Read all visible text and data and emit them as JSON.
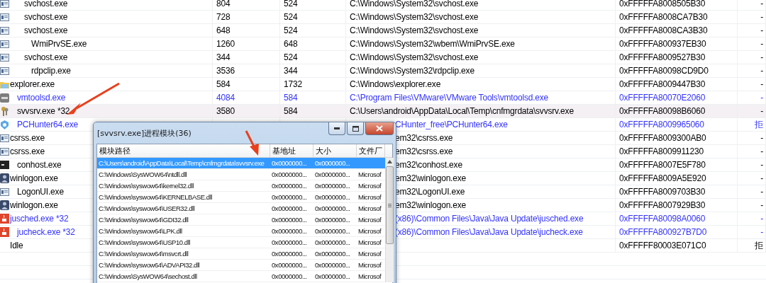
{
  "process_table": {
    "subtree_of_row_above": [
      {
        "name": "svchost.exe",
        "pid": "804",
        "ppid": "524",
        "path": "C:\\Windows\\System32\\svchost.exe",
        "address": "0xFFFFFA8008505B30",
        "status": "-",
        "kind": "service",
        "color": "#000000",
        "selected": false,
        "covered_by_window": false
      },
      {
        "name": "svchost.exe",
        "pid": "728",
        "ppid": "524",
        "path": "C:\\Windows\\System32\\svchost.exe",
        "address": "0xFFFFFA8008CA7B30",
        "status": "-",
        "kind": "service",
        "color": "#000000",
        "selected": false,
        "covered_by_window": false
      },
      {
        "name": "svchost.exe",
        "pid": "648",
        "ppid": "524",
        "path": "C:\\Windows\\System32\\svchost.exe",
        "address": "0xFFFFFA8008CA3B30",
        "status": "-",
        "kind": "service",
        "color": "#000000",
        "selected": false,
        "covered_by_window": false,
        "children": [
          {
            "name": "WmiPrvSE.exe",
            "pid": "1260",
            "ppid": "648",
            "path": "C:\\Windows\\System32\\wbem\\WmiPrvSE.exe",
            "address": "0xFFFFFA800937EB30",
            "status": "-",
            "kind": "service",
            "color": "#000000",
            "selected": false,
            "covered_by_window": false
          }
        ]
      },
      {
        "name": "svchost.exe",
        "pid": "344",
        "ppid": "524",
        "path": "C:\\Windows\\System32\\svchost.exe",
        "address": "0xFFFFFA8009527B30",
        "status": "-",
        "kind": "service",
        "color": "#000000",
        "selected": false,
        "covered_by_window": false,
        "children": [
          {
            "name": "rdpclip.exe",
            "pid": "3536",
            "ppid": "344",
            "path": "C:\\Windows\\System32\\rdpclip.exe",
            "address": "0xFFFFFA80098CD9D0",
            "status": "-",
            "kind": "service",
            "color": "#000000",
            "selected": false,
            "covered_by_window": false
          }
        ]
      }
    ],
    "roots": [
      {
        "name": "explorer.exe",
        "pid": "584",
        "ppid": "1732",
        "path": "C:\\Windows\\explorer.exe",
        "address": "0xFFFFFA8009447B30",
        "status": "-",
        "kind": "folder",
        "color": "#000000",
        "selected": false,
        "covered_by_window": false,
        "children": [
          {
            "name": "vmtoolsd.exe",
            "pid": "4084",
            "ppid": "584",
            "path": "C:\\Program Files\\VMware\\VMware Tools\\vmtoolsd.exe",
            "address": "0xFFFFFA80070E2060",
            "status": "-",
            "kind": "vm",
            "color": "#3333ff",
            "selected": false,
            "covered_by_window": false
          },
          {
            "name": "svvsrv.exe *32",
            "pid": "3580",
            "ppid": "584",
            "path": "C:\\Users\\android\\AppData\\Local\\Temp\\cnfmgrdata\\svvsrv.exe",
            "address": "0xFFFFFA80098B6060",
            "status": "-",
            "kind": "keys",
            "color": "#000000",
            "selected": true,
            "covered_by_window": false
          },
          {
            "name": "PCHunter64.exe",
            "path": "CHunter_free\\PCHunter64.exe",
            "address": "0xFFFFFA8009965060",
            "status": "拒",
            "kind": "shield",
            "color": "#3333ff",
            "selected": false,
            "covered_by_window": true
          }
        ]
      },
      {
        "name": "csrss.exe",
        "path": "em32\\csrss.exe",
        "address": "0xFFFFFA8009300AB0",
        "status": "-",
        "kind": "service",
        "color": "#000000",
        "selected": false,
        "covered_by_window": true
      },
      {
        "name": "csrss.exe",
        "path": "em32\\csrss.exe",
        "address": "0xFFFFFA8009911230",
        "status": "-",
        "kind": "service",
        "color": "#000000",
        "selected": false,
        "covered_by_window": true,
        "children": [
          {
            "name": "conhost.exe",
            "path": "em32\\conhost.exe",
            "address": "0xFFFFFA8007E5F780",
            "status": "-",
            "kind": "console",
            "color": "#000000",
            "selected": false,
            "covered_by_window": true
          }
        ]
      },
      {
        "name": "winlogon.exe",
        "path": "em32\\winlogon.exe",
        "address": "0xFFFFFA8009A5E920",
        "status": "-",
        "kind": "user",
        "color": "#000000",
        "selected": false,
        "covered_by_window": true,
        "children": [
          {
            "name": "LogonUI.exe",
            "path": "em32\\LogonUI.exe",
            "address": "0xFFFFFA8009703B30",
            "status": "-",
            "kind": "service",
            "color": "#000000",
            "selected": false,
            "covered_by_window": true
          }
        ]
      },
      {
        "name": "winlogon.exe",
        "path": "em32\\winlogon.exe",
        "address": "0xFFFFFA8007929B30",
        "status": "-",
        "kind": "user",
        "color": "#000000",
        "selected": false,
        "covered_by_window": true
      },
      {
        "name": "jusched.exe *32",
        "path": "(x86)\\Common Files\\Java\\Java Update\\jusched.exe",
        "address": "0xFFFFFA80098A0060",
        "status": "-",
        "kind": "java",
        "color": "#3333ff",
        "selected": false,
        "covered_by_window": true,
        "children": [
          {
            "name": "jucheck.exe *32",
            "path": "(x86)\\Common Files\\Java\\Java Update\\jucheck.exe",
            "address": "0xFFFFFA800927B7D0",
            "status": "-",
            "kind": "java",
            "color": "#3333ff",
            "selected": false,
            "covered_by_window": true
          }
        ]
      },
      {
        "name": "Idle",
        "address": "0xFFFFF80003E071C0",
        "status": "拒",
        "kind": "none",
        "color": "#000000",
        "selected": false
      }
    ]
  },
  "module_window": {
    "title": "[svvsrv.exe]进程模块(36)",
    "columns": [
      "模块路径",
      "基地址",
      "大小",
      "文件厂"
    ],
    "rows": [
      {
        "cells": [
          "C:\\Users\\android\\AppData\\Local\\Temp\\cnfmgrdata\\svvsrv.exe",
          "0x0000000...",
          "0x0000000..."
        ],
        "selected": true
      },
      {
        "cells": [
          "C:\\Windows\\SysWOW64\\ntdll.dll",
          "0x0000000...",
          "0x0000000...",
          "Microsof"
        ],
        "selected": false
      },
      {
        "cells": [
          "C:\\Windows\\syswow64\\kernel32.dll",
          "0x0000000...",
          "0x0000000...",
          "Microsof"
        ],
        "selected": false
      },
      {
        "cells": [
          "C:\\Windows\\syswow64\\KERNELBASE.dll",
          "0x0000000...",
          "0x0000000...",
          "Microsof"
        ],
        "selected": false
      },
      {
        "cells": [
          "C:\\Windows\\syswow64\\USER32.dll",
          "0x0000000...",
          "0x0000000...",
          "Microsof"
        ],
        "selected": false
      },
      {
        "cells": [
          "C:\\Windows\\syswow64\\GDI32.dll",
          "0x0000000...",
          "0x0000000...",
          "Microsof"
        ],
        "selected": false
      },
      {
        "cells": [
          "C:\\Windows\\syswow64\\LPK.dll",
          "0x0000000...",
          "0x0000000...",
          "Microsof"
        ],
        "selected": false
      },
      {
        "cells": [
          "C:\\Windows\\syswow64\\USP10.dll",
          "0x0000000...",
          "0x0000000...",
          "Microsof"
        ],
        "selected": false
      },
      {
        "cells": [
          "C:\\Windows\\syswow64\\msvcrt.dll",
          "0x0000000...",
          "0x0000000...",
          "Microsof"
        ],
        "selected": false
      },
      {
        "cells": [
          "C:\\Windows\\syswow64\\ADVAPI32.dll",
          "0x0000000...",
          "0x0000000...",
          "Microsof"
        ],
        "selected": false
      },
      {
        "cells": [
          "C:\\Windows\\SysWOW64\\sechost.dll",
          "0x0000000...",
          "0x0000000...",
          "Microsof"
        ],
        "selected": false
      }
    ]
  }
}
